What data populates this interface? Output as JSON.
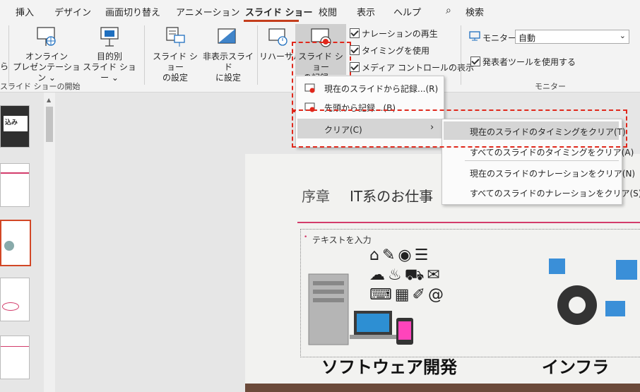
{
  "tabs": [
    "挿入",
    "デザイン",
    "画面切り替え",
    "アニメーション",
    "スライド ショー",
    "校閲",
    "表示",
    "ヘルプ"
  ],
  "search_label": "検索",
  "ribbon": {
    "left_partial": "ら",
    "online_presentation": "オンライン\nプレゼンテーション ⌄",
    "custom_show": "目的別\nスライド ショー ⌄",
    "group_start": "スライド ショーの開始",
    "setup_show": "スライド ショー\nの設定",
    "hide_slide": "非表示スライド\nに設定",
    "rehearse": "リハーサル",
    "record": "スライド ショー\nの記録 ⌄",
    "chk_narration": "ナレーションの再生",
    "chk_timing": "タイミングを使用",
    "chk_media": "メディア コントロールの表示",
    "monitor_label": "モニター:",
    "monitor_value": "自動",
    "presenter_view": "発表者ツールを使用する",
    "group_monitor": "モニター"
  },
  "record_menu": {
    "from_current": "現在のスライドから記録...(R)",
    "from_beginning": "先頭から記録...(B)",
    "clear": "クリア(C)"
  },
  "clear_menu": {
    "clear_timing_current": "現在のスライドのタイミングをクリア(T)",
    "clear_timing_all": "すべてのスライドのタイミングをクリア(A)",
    "clear_narration_current": "現在のスライドのナレーションをクリア(N)",
    "clear_narration_all": "すべてのスライドのナレーションをクリア(S)"
  },
  "slide": {
    "title_prefix": "序章",
    "title_main": "IT系のお仕事",
    "bullet": "テキストを入力",
    "label_software": "ソフトウェア開発",
    "label_infra": "インフラ"
  },
  "thumbs": [
    "込み"
  ]
}
